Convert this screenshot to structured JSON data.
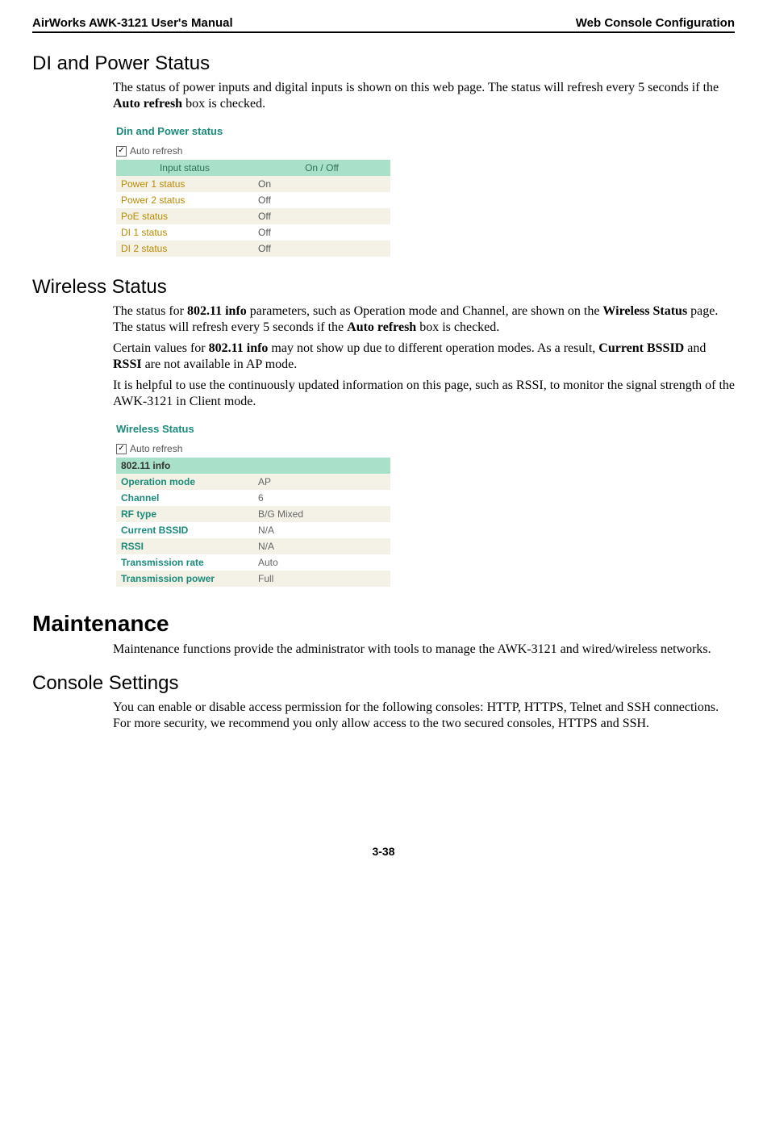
{
  "header": {
    "left": "AirWorks AWK-3121 User's Manual",
    "right": "Web Console Configuration"
  },
  "sections": {
    "di": {
      "heading": "DI and Power Status",
      "para1_a": "The status of power inputs and digital inputs is shown on this web page. The status will refresh every 5 seconds if the ",
      "para1_bold": "Auto refresh",
      "para1_b": " box is checked.",
      "widget": {
        "title": "Din and Power status",
        "auto_refresh_label": "Auto refresh",
        "th_left": "Input status",
        "th_right": "On / Off",
        "rows": [
          {
            "label": "Power 1 status",
            "value": "On"
          },
          {
            "label": "Power 2 status",
            "value": "Off"
          },
          {
            "label": "PoE status",
            "value": "Off"
          },
          {
            "label": "DI 1 status",
            "value": "Off"
          },
          {
            "label": "DI 2 status",
            "value": "Off"
          }
        ]
      }
    },
    "wireless": {
      "heading": "Wireless Status",
      "p1_a": "The status for ",
      "p1_b": "802.11 info",
      "p1_c": " parameters, such as Operation mode and Channel, are shown on the ",
      "p1_d": "Wireless Status",
      "p1_e": " page. The status will refresh every 5 seconds if the ",
      "p1_f": "Auto refresh",
      "p1_g": " box is checked.",
      "p2_a": "Certain values for ",
      "p2_b": "802.11 info",
      "p2_c": " may not show up due to different operation modes. As a result, ",
      "p2_d": "Current BSSID",
      "p2_e": " and ",
      "p2_f": "RSSI",
      "p2_g": " are not available in AP mode.",
      "p3": "It is helpful to use the continuously updated information on this page, such as RSSI, to monitor the signal strength of the AWK-3121 in Client mode.",
      "widget": {
        "title": "Wireless Status",
        "auto_refresh_label": "Auto refresh",
        "section_header": "802.11 info",
        "rows": [
          {
            "label": "Operation mode",
            "value": "AP"
          },
          {
            "label": "Channel",
            "value": "6"
          },
          {
            "label": "RF type",
            "value": "B/G Mixed"
          },
          {
            "label": "Current BSSID",
            "value": "N/A"
          },
          {
            "label": "RSSI",
            "value": "N/A"
          },
          {
            "label": "Transmission rate",
            "value": "Auto"
          },
          {
            "label": "Transmission power",
            "value": "Full"
          }
        ]
      }
    },
    "maintenance": {
      "heading": "Maintenance",
      "para": "Maintenance functions provide the administrator with tools to manage the AWK-3121 and wired/wireless networks."
    },
    "console": {
      "heading": "Console Settings",
      "para": "You can enable or disable access permission for the following consoles: HTTP, HTTPS, Telnet and SSH connections. For more security, we recommend you only allow access to the two secured consoles, HTTPS and SSH."
    }
  },
  "footer": {
    "page_number": "3-38"
  }
}
